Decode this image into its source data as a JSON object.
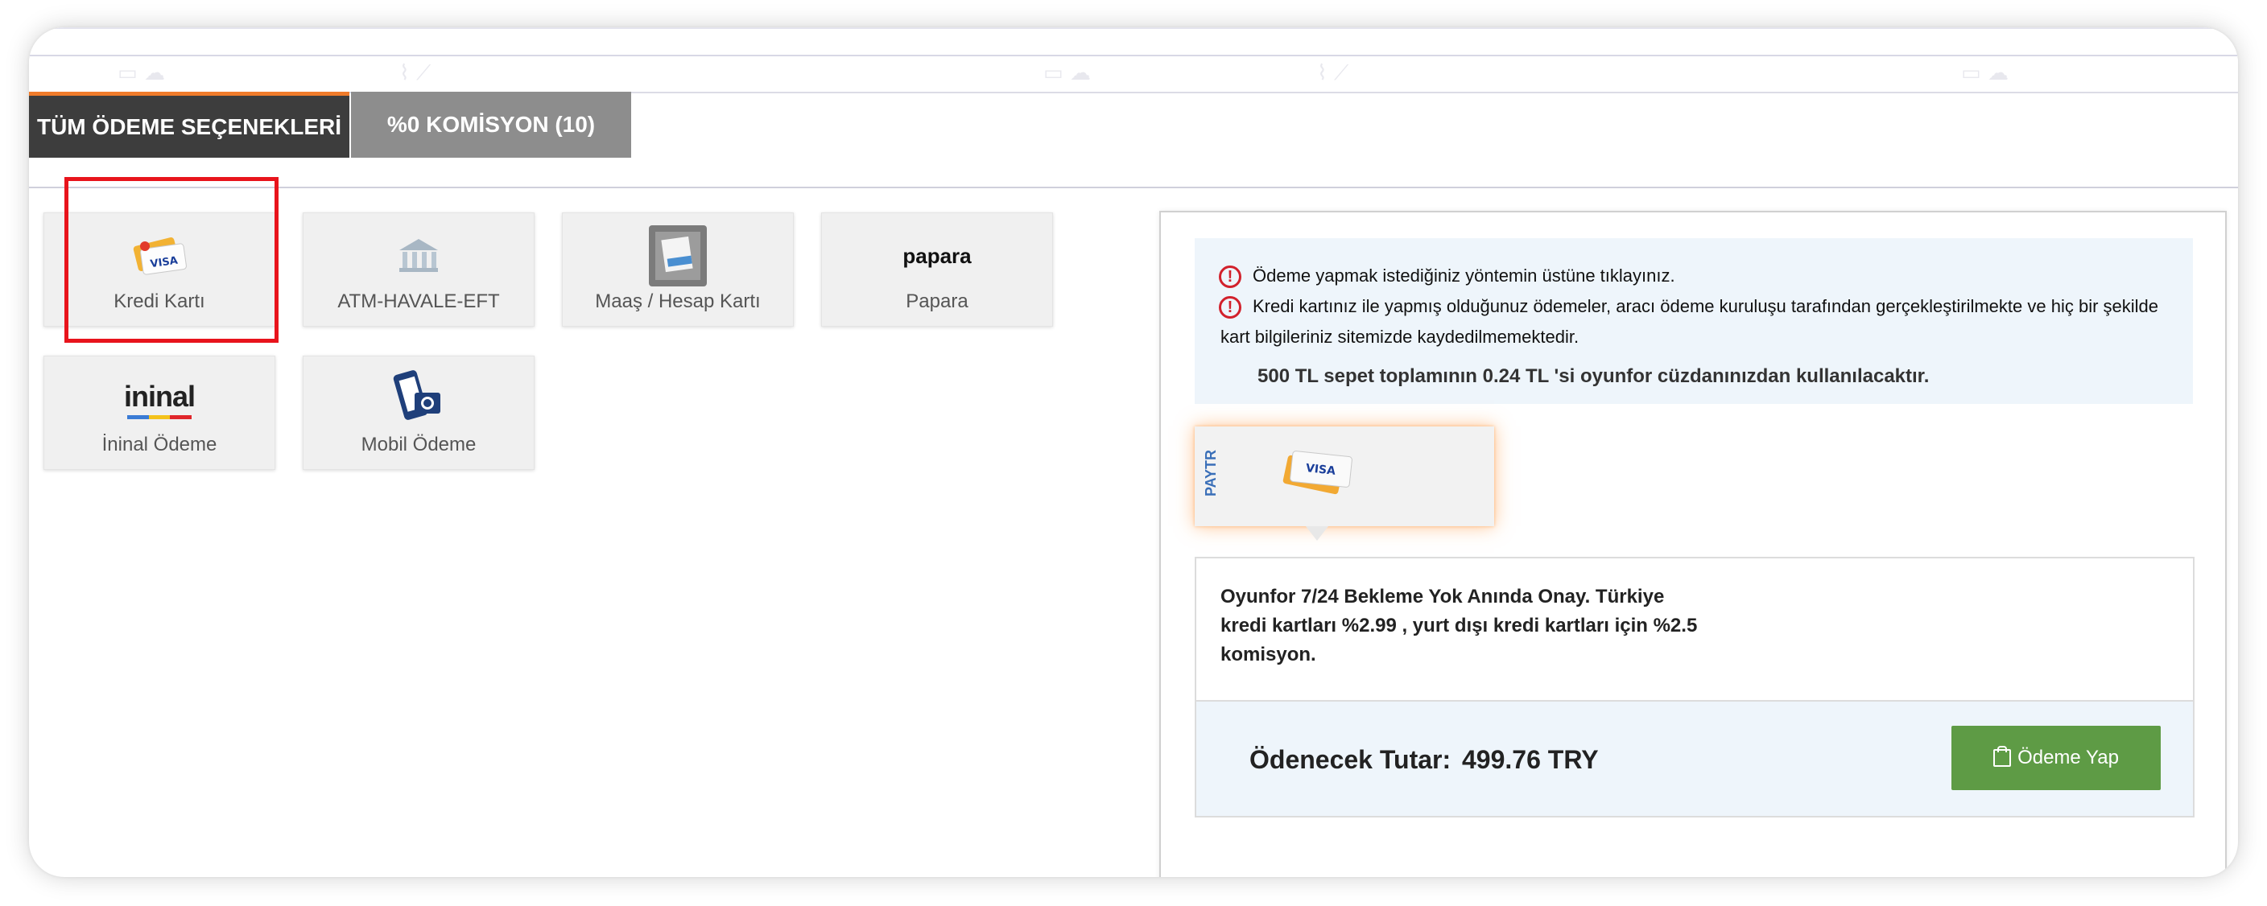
{
  "tabs": [
    {
      "label": "TÜM ÖDEME SEÇENEKLERİ"
    },
    {
      "label": "%0 KOMİSYON (10)"
    }
  ],
  "methods": [
    {
      "label": "Kredi Kartı",
      "icon": "credit-card-icon"
    },
    {
      "label": "ATM-HAVALE-EFT",
      "icon": "bank-icon"
    },
    {
      "label": "Maaş / Hesap Kartı",
      "icon": "atm-icon"
    },
    {
      "label": "Papara",
      "icon": "papara-logo",
      "logo_text": "papara"
    },
    {
      "label": "İninal Ödeme",
      "icon": "ininal-logo",
      "logo_text": "ininal"
    },
    {
      "label": "Mobil Ödeme",
      "icon": "mobile-payment-icon"
    }
  ],
  "info": {
    "line1": "Ödeme yapmak istediğiniz yöntemin üstüne tıklayınız.",
    "line2a": "Kredi kartınız ile yapmış olduğunuz ödemeler, aracı ödeme kuruluşu tarafından gerçekleştirilmekte ve hiç bir şekilde",
    "line2b": "kart bilgileriniz sitemizde kaydedilmemektedir.",
    "wallet": "500 TL sepet toplamının 0.24 TL 'si oyunfor cüzdanınızdan kullanılacaktır."
  },
  "provider": {
    "name": "PAYTR"
  },
  "description": "Oyunfor 7/24 Bekleme Yok Anında Onay. Türkiye kredi kartları %2.99 , yurt dışı kredi kartları için %2.5 komisyon.",
  "total": {
    "label": "Ödenecek Tutar:",
    "amount": "499.76 TRY"
  },
  "pay_button": "Ödeme Yap",
  "colors": {
    "accent": "#f07b2a",
    "pay_green": "#5e9b45",
    "highlight_red": "#e8141c"
  }
}
